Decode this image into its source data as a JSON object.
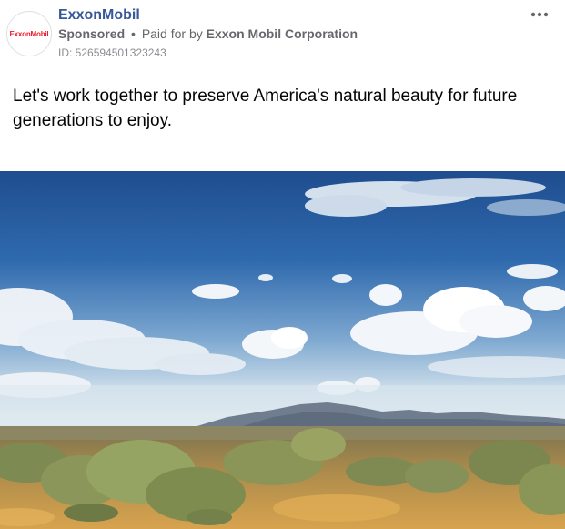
{
  "post": {
    "advertiser_name": "ExxonMobil",
    "avatar_logo_text": "ExxonMobil",
    "sponsored_label": "Sponsored",
    "separator": "•",
    "paid_for_label": "Paid for by",
    "paid_for_entity": "Exxon Mobil Corporation",
    "ad_id": "ID: 526594501323243",
    "caption": "Let's work together to preserve America's natural beauty for future generations to enjoy.",
    "more_icon": "more-horizontal-icon",
    "image_description_icon": "landscape-photo"
  },
  "colors": {
    "brand_red": "#ed1b2d",
    "link_blue": "#385898",
    "meta_gray": "#65676b"
  }
}
